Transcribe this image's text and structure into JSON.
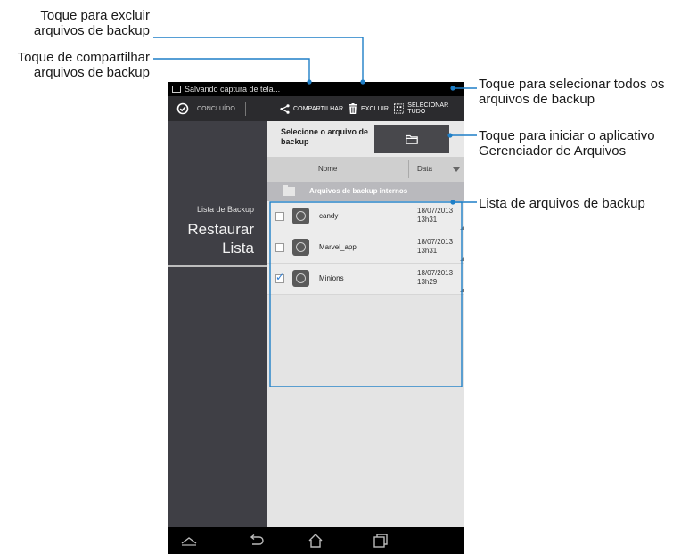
{
  "callouts": {
    "delete": "Toque para excluir\narquivos de backup",
    "share": "Toque de compartilhar\narquivos de backup",
    "select_all": "Toque para selecionar todos os\narquivos de backup",
    "file_manager": "Toque para iniciar o aplicativo\nGerenciador de Arquivos",
    "backup_list": "Lista de arquivos de backup"
  },
  "colors": {
    "callout_line": "#1f7fc7",
    "action_bar": "#2b2b2e",
    "left_panel": "#3f3f45",
    "check_blue": "#2f7fd6"
  },
  "status_bar": {
    "text": "Salvando captura de tela..."
  },
  "action_bar": {
    "done_label": "CONCLUÍDO",
    "share_label": "COMPARTILHAR",
    "delete_label": "EXCLUIR",
    "select_all_label": "SELECIONAR TUDO"
  },
  "left_panel": {
    "small_label": "Lista de Backup",
    "big_label": "Restaurar\nLista"
  },
  "file_select": {
    "label": "Selecione o arquivo de backup",
    "icon": "folder-icon"
  },
  "columns": {
    "name": "Nome",
    "date": "Data"
  },
  "group": {
    "label": "Arquivos de backup internos"
  },
  "files": [
    {
      "name": "candy",
      "date": "18/07/2013",
      "time": "13h31",
      "checked": false
    },
    {
      "name": "Marvel_app",
      "date": "18/07/2013",
      "time": "13h31",
      "checked": false
    },
    {
      "name": "Minions",
      "date": "18/07/2013",
      "time": "13h29",
      "checked": true
    }
  ],
  "nav_icons": [
    "collapse-icon",
    "back-icon",
    "home-icon",
    "recent-apps-icon"
  ]
}
